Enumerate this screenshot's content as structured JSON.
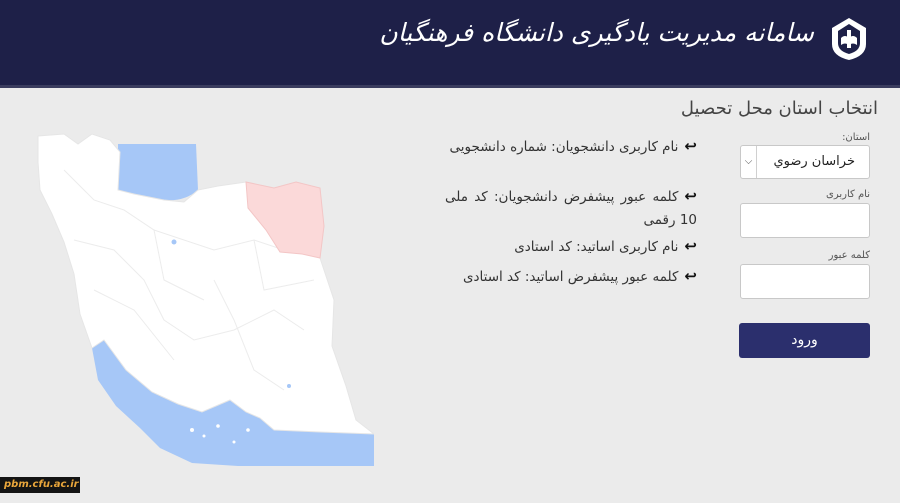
{
  "header": {
    "system_title": "سامانه مدیریت یادگیری دانشگاه فرهنگیان",
    "logo_icon": "university-emblem-icon"
  },
  "page": {
    "title": "انتخاب استان محل تحصیل"
  },
  "form": {
    "province_label": "استان:",
    "province_value": "خراسان رضوي",
    "username_label": "نام کاربری",
    "password_label": "کلمه عبور",
    "login_label": "ورود"
  },
  "info": {
    "arrow_icon": "return-arrow-icon",
    "items": [
      "نام کاربری دانشجویان: شماره دانشجویی",
      "کلمه عبور پیشفرض دانشجویان: کد ملی 10 رقمی",
      "نام کاربری اساتید: کد استادی",
      "کلمه عبور پیشفرض اساتید: کد استادی"
    ]
  },
  "footer": {
    "site": "pbm.cfu.ac.ir"
  },
  "colors": {
    "header_bg": "#1e2048",
    "button_bg": "#2b2f6d",
    "water": "#a6c7f7",
    "selected_province": "#fbd9d9",
    "land": "#ffffff"
  }
}
